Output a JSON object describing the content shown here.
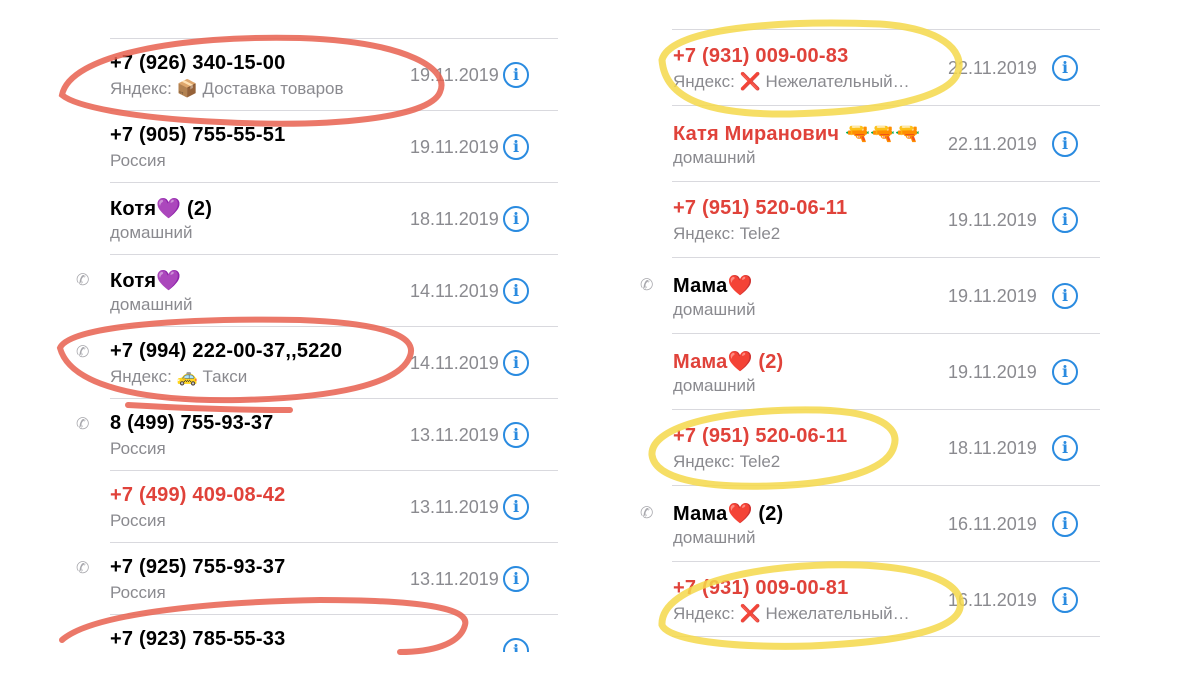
{
  "left": {
    "rows": [
      {
        "name": "+7 (926) 340-15-00",
        "missed": false,
        "sub": "Яндекс: 📦 Доставка товаров",
        "date": "19.11.2019",
        "outgoing": false
      },
      {
        "name": "+7 (905) 755-55-51",
        "missed": false,
        "sub": "Россия",
        "date": "19.11.2019",
        "outgoing": false
      },
      {
        "name": "Котя💜 (2)",
        "missed": false,
        "sub": "домашний",
        "date": "18.11.2019",
        "outgoing": false
      },
      {
        "name": "Котя💜",
        "missed": false,
        "sub": "домашний",
        "date": "14.11.2019",
        "outgoing": true
      },
      {
        "name": "+7 (994) 222-00-37,,5220",
        "missed": false,
        "sub": "Яндекс: 🚕 Такси",
        "date": "14.11.2019",
        "outgoing": true
      },
      {
        "name": "8 (499) 755-93-37",
        "missed": false,
        "sub": "Россия",
        "date": "13.11.2019",
        "outgoing": true
      },
      {
        "name": "+7 (499) 409-08-42",
        "missed": true,
        "sub": "Россия",
        "date": "13.11.2019",
        "outgoing": false
      },
      {
        "name": "+7 (925) 755-93-37",
        "missed": false,
        "sub": "Россия",
        "date": "13.11.2019",
        "outgoing": true
      },
      {
        "name": "+7 (923) 785-55-33",
        "missed": false,
        "sub": "",
        "date": "",
        "outgoing": false
      }
    ]
  },
  "right": {
    "rows": [
      {
        "name": "+7 (931) 009-00-83",
        "missed": true,
        "sub": "Яндекс: ❌ Нежелательный…",
        "date": "22.11.2019",
        "outgoing": false
      },
      {
        "name": "Катя Миранович 🔫🔫🔫",
        "missed": true,
        "sub": "домашний",
        "date": "22.11.2019",
        "outgoing": false
      },
      {
        "name": "+7 (951) 520-06-11",
        "missed": true,
        "sub": "Яндекс: Tele2",
        "date": "19.11.2019",
        "outgoing": false
      },
      {
        "name": "Мама❤️",
        "missed": false,
        "sub": "домашний",
        "date": "19.11.2019",
        "outgoing": true
      },
      {
        "name": "Мама❤️ (2)",
        "missed": true,
        "sub": "домашний",
        "date": "19.11.2019",
        "outgoing": false
      },
      {
        "name": "+7 (951) 520-06-11",
        "missed": true,
        "sub": "Яндекс: Tele2",
        "date": "18.11.2019",
        "outgoing": false
      },
      {
        "name": "Мама❤️ (2)",
        "missed": false,
        "sub": "домашний",
        "date": "16.11.2019",
        "outgoing": true
      },
      {
        "name": "+7 (931) 009-00-81",
        "missed": true,
        "sub": "Яндекс: ❌ Нежелательный…",
        "date": "16.11.2019",
        "outgoing": false
      }
    ]
  },
  "icons": {
    "info": "info-icon",
    "outgoing": "outgoing-call-icon",
    "info_glyph": "i",
    "outgoing_glyph": "✆"
  },
  "colors": {
    "missed": "#e0423a",
    "info": "#2a8be0",
    "red_marker": "#e8604f",
    "yellow_marker": "#f5d84a"
  }
}
